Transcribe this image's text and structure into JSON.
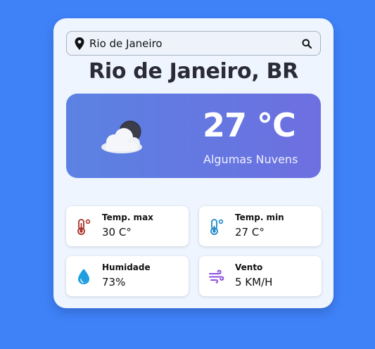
{
  "search": {
    "value": "Rio de Janeiro",
    "placeholder": ""
  },
  "location": {
    "city_title": "Rio de Janeiro, BR"
  },
  "current": {
    "temperature": "27 °C",
    "description": "Algumas Nuvens",
    "icon": "partly-cloudy-icon"
  },
  "details": {
    "temp_max": {
      "label": "Temp. max",
      "value": "30 C°",
      "icon": "thermometer-hot-icon"
    },
    "temp_min": {
      "label": "Temp. min",
      "value": "27 C°",
      "icon": "thermometer-cold-icon"
    },
    "humidity": {
      "label": "Humidade",
      "value": "73%",
      "icon": "water-drop-icon"
    },
    "wind": {
      "label": "Vento",
      "value": "5 KM/H",
      "icon": "wind-icon"
    }
  },
  "colors": {
    "background": "#3f82f8",
    "card": "#eef5ff",
    "hero_gradient_start": "#5b82e3",
    "hero_gradient_end": "#6d6fe0",
    "hot": "#a8302a",
    "cold": "#1e88c8",
    "humidity": "#1f9fe0",
    "wind": "#8a4fe0"
  }
}
